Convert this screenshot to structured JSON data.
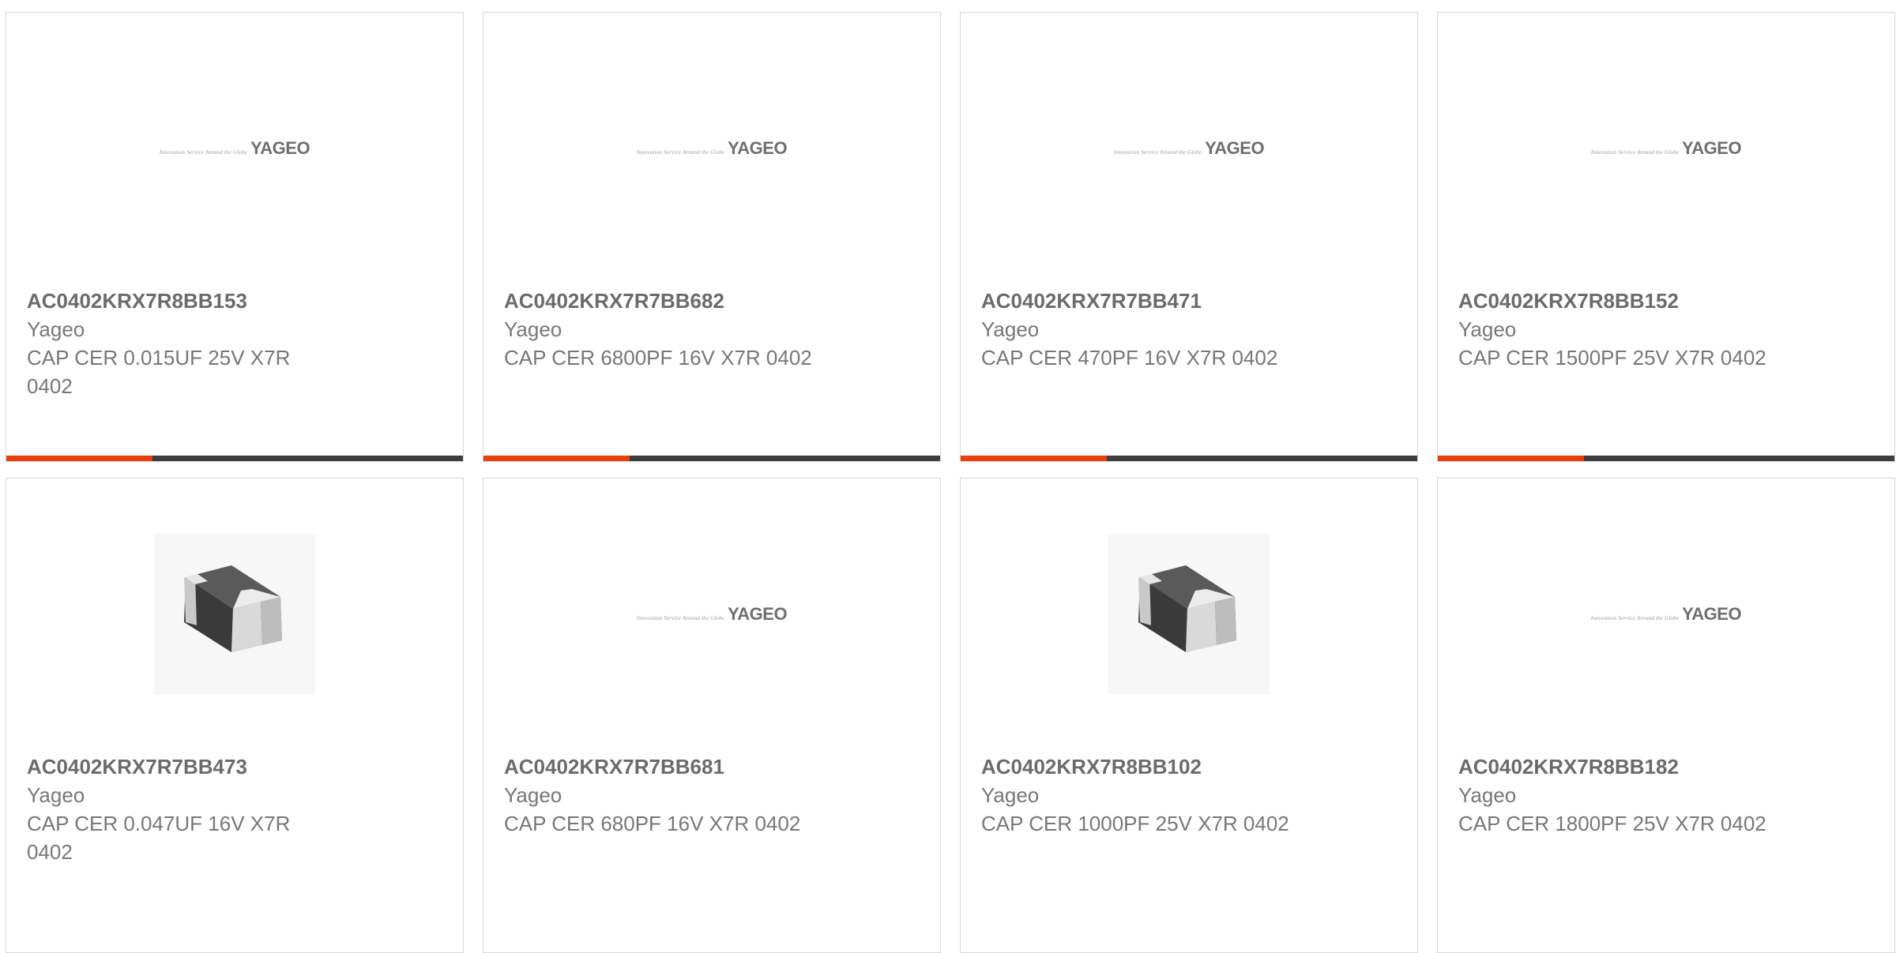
{
  "colors": {
    "accent": "#e8400c",
    "track": "#3d3d3d",
    "border": "#d6d6d6",
    "text_primary": "#6b6b6b",
    "text_secondary": "#777777"
  },
  "products": [
    {
      "part_number": "AC0402KRX7R8BB153",
      "manufacturer": "Yageo",
      "description": "CAP CER 0.015UF 25V X7R 0402",
      "image": "yageo-logo",
      "logo_tagline": "Innovation Service Around the Globe",
      "logo_text": "YAGEO",
      "progress": 0.32
    },
    {
      "part_number": "AC0402KRX7R7BB682",
      "manufacturer": "Yageo",
      "description": "CAP CER 6800PF 16V X7R 0402",
      "image": "yageo-logo",
      "logo_tagline": "Innovation Service Around the Globe",
      "logo_text": "YAGEO",
      "progress": 0.32
    },
    {
      "part_number": "AC0402KRX7R7BB471",
      "manufacturer": "Yageo",
      "description": "CAP CER 470PF 16V X7R 0402",
      "image": "yageo-logo",
      "logo_tagline": "Innovation Service Around the Globe",
      "logo_text": "YAGEO",
      "progress": 0.32
    },
    {
      "part_number": "AC0402KRX7R8BB152",
      "manufacturer": "Yageo",
      "description": "CAP CER 1500PF 25V X7R 0402",
      "image": "yageo-logo",
      "logo_tagline": "Innovation Service Around the Globe",
      "logo_text": "YAGEO",
      "progress": 0.32
    },
    {
      "part_number": "AC0402KRX7R7BB473",
      "manufacturer": "Yageo",
      "description": "CAP CER 0.047UF 16V X7R 0402",
      "image": "chip-capacitor-photo",
      "logo_tagline": "",
      "logo_text": "",
      "progress": null
    },
    {
      "part_number": "AC0402KRX7R7BB681",
      "manufacturer": "Yageo",
      "description": "CAP CER 680PF 16V X7R 0402",
      "image": "yageo-logo",
      "logo_tagline": "Innovation Service Around the Globe",
      "logo_text": "YAGEO",
      "progress": null
    },
    {
      "part_number": "AC0402KRX7R8BB102",
      "manufacturer": "Yageo",
      "description": "CAP CER 1000PF 25V X7R 0402",
      "image": "chip-capacitor-photo",
      "logo_tagline": "",
      "logo_text": "",
      "progress": null
    },
    {
      "part_number": "AC0402KRX7R8BB182",
      "manufacturer": "Yageo",
      "description": "CAP CER 1800PF 25V X7R 0402",
      "image": "yageo-logo",
      "logo_tagline": "Innovation Service Around the Globe",
      "logo_text": "YAGEO",
      "progress": null
    }
  ]
}
